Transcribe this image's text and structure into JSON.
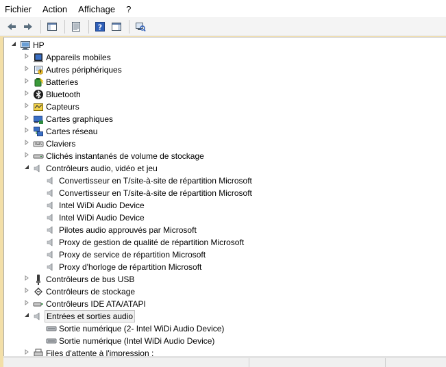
{
  "menu": [
    "Fichier",
    "Action",
    "Affichage",
    "?"
  ],
  "toolbar": [
    {
      "name": "back-arrow-icon",
      "kind": "arrow-left"
    },
    {
      "name": "forward-arrow-icon",
      "kind": "arrow-right"
    },
    {
      "sep": true
    },
    {
      "name": "show-hide-console-tree-icon",
      "kind": "pane"
    },
    {
      "sep": true
    },
    {
      "name": "properties-icon",
      "kind": "props"
    },
    {
      "sep": true
    },
    {
      "name": "help-icon",
      "kind": "help"
    },
    {
      "name": "show-hide-action-pane-icon",
      "kind": "pane2"
    },
    {
      "sep": true
    },
    {
      "name": "scan-hardware-changes-icon",
      "kind": "scan"
    }
  ],
  "tree": [
    {
      "label": "HP",
      "level": 0,
      "exp": "expanded",
      "icon": "computer"
    },
    {
      "label": "Appareils mobiles",
      "level": 1,
      "exp": "collapsed",
      "icon": "mobile"
    },
    {
      "label": "Autres périphériques",
      "level": 1,
      "exp": "collapsed",
      "icon": "unknown-device"
    },
    {
      "label": "Batteries",
      "level": 1,
      "exp": "collapsed",
      "icon": "battery"
    },
    {
      "label": "Bluetooth",
      "level": 1,
      "exp": "collapsed",
      "icon": "bluetooth"
    },
    {
      "label": "Capteurs",
      "level": 1,
      "exp": "collapsed",
      "icon": "sensor"
    },
    {
      "label": "Cartes graphiques",
      "level": 1,
      "exp": "collapsed",
      "icon": "display-adapter"
    },
    {
      "label": "Cartes réseau",
      "level": 1,
      "exp": "collapsed",
      "icon": "network"
    },
    {
      "label": "Claviers",
      "level": 1,
      "exp": "collapsed",
      "icon": "keyboard"
    },
    {
      "label": "Clichés instantanés de volume de stockage",
      "level": 1,
      "exp": "collapsed",
      "icon": "storage-volume"
    },
    {
      "label": "Contrôleurs audio, vidéo et jeu",
      "level": 1,
      "exp": "expanded",
      "icon": "speaker"
    },
    {
      "label": "Convertisseur en T/site-à-site de répartition Microsoft",
      "level": 2,
      "exp": "none",
      "icon": "speaker"
    },
    {
      "label": "Convertisseur en T/site-à-site de répartition Microsoft",
      "level": 2,
      "exp": "none",
      "icon": "speaker"
    },
    {
      "label": "Intel WiDi Audio Device",
      "level": 2,
      "exp": "none",
      "icon": "speaker"
    },
    {
      "label": "Intel WiDi Audio Device",
      "level": 2,
      "exp": "none",
      "icon": "speaker"
    },
    {
      "label": "Pilotes audio approuvés par Microsoft",
      "level": 2,
      "exp": "none",
      "icon": "speaker"
    },
    {
      "label": "Proxy de gestion de qualité de répartition Microsoft",
      "level": 2,
      "exp": "none",
      "icon": "speaker"
    },
    {
      "label": "Proxy de service de répartition Microsoft",
      "level": 2,
      "exp": "none",
      "icon": "speaker"
    },
    {
      "label": "Proxy d'horloge de répartition Microsoft",
      "level": 2,
      "exp": "none",
      "icon": "speaker"
    },
    {
      "label": "Contrôleurs de bus USB",
      "level": 1,
      "exp": "collapsed",
      "icon": "usb"
    },
    {
      "label": "Contrôleurs de stockage",
      "level": 1,
      "exp": "collapsed",
      "icon": "storage-controller"
    },
    {
      "label": "Contrôleurs IDE ATA/ATAPI",
      "level": 1,
      "exp": "collapsed",
      "icon": "ide"
    },
    {
      "label": "Entrées et sorties audio",
      "level": 1,
      "exp": "expanded",
      "icon": "speaker",
      "selected": true
    },
    {
      "label": "Sortie numérique (2- Intel WiDi Audio Device)",
      "level": 2,
      "exp": "none",
      "icon": "audio-output"
    },
    {
      "label": "Sortie numérique (Intel WiDi Audio Device)",
      "level": 2,
      "exp": "none",
      "icon": "audio-output"
    },
    {
      "label": "Files d'attente à l'impression :",
      "level": 1,
      "exp": "collapsed",
      "icon": "printer"
    }
  ]
}
